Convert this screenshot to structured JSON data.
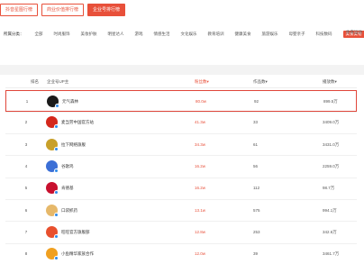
{
  "top_tabs": [
    {
      "label": "抖音星图行榜"
    },
    {
      "label": "商业价值排行榜"
    },
    {
      "label": "企业号排行榜"
    }
  ],
  "categories": {
    "label": "所属分类：",
    "items": [
      "全部",
      "时尚服饰",
      "美妆护肤",
      "明星达人",
      "游戏",
      "情感生活",
      "文化娱乐",
      "教育培训",
      "健康美食",
      "旅游娱乐",
      "母婴亲子",
      "科技数码",
      "美食美物"
    ],
    "more": "体育运动"
  },
  "table": {
    "headers": {
      "rank": "排名",
      "name": "企业号UP主",
      "fans": "粉丝数▾",
      "works": "作品数▾",
      "plays": "播放数▾"
    },
    "rows": [
      {
        "rank": "1",
        "name": "元气森林",
        "fans": "80.0w",
        "works": "92",
        "plays": "899.5万",
        "avatar_color": "#1a1a1a"
      },
      {
        "rank": "2",
        "name": "麦当劳中国官方站",
        "fans": "41.3w",
        "works": "33",
        "plays": "3409.0万",
        "avatar_color": "#d4281c"
      },
      {
        "rank": "3",
        "name": "拉下网络旗舰",
        "fans": "34.3w",
        "works": "61",
        "plays": "3431.0万",
        "avatar_color": "#c8a02a"
      },
      {
        "rank": "4",
        "name": "谷歌鸡",
        "fans": "16.2w",
        "works": "56",
        "plays": "2259.0万",
        "avatar_color": "#3b6fd6"
      },
      {
        "rank": "5",
        "name": "肯德基",
        "fans": "16.2w",
        "works": "112",
        "plays": "98.7万",
        "avatar_color": "#c8102e"
      },
      {
        "rank": "6",
        "name": "口袋抓药",
        "fans": "13.1w",
        "works": "575",
        "plays": "994.1万",
        "avatar_color": "#e6b86a"
      },
      {
        "rank": "7",
        "name": "旺旺官方旗舰部",
        "fans": "12.8w",
        "works": "253",
        "plays": "342.6万",
        "avatar_color": "#e8502e"
      },
      {
        "rank": "8",
        "name": "小鱼精华家族合作",
        "fans": "12.0w",
        "works": "39",
        "plays": "3461.7万",
        "avatar_color": "#f0a020"
      }
    ]
  }
}
